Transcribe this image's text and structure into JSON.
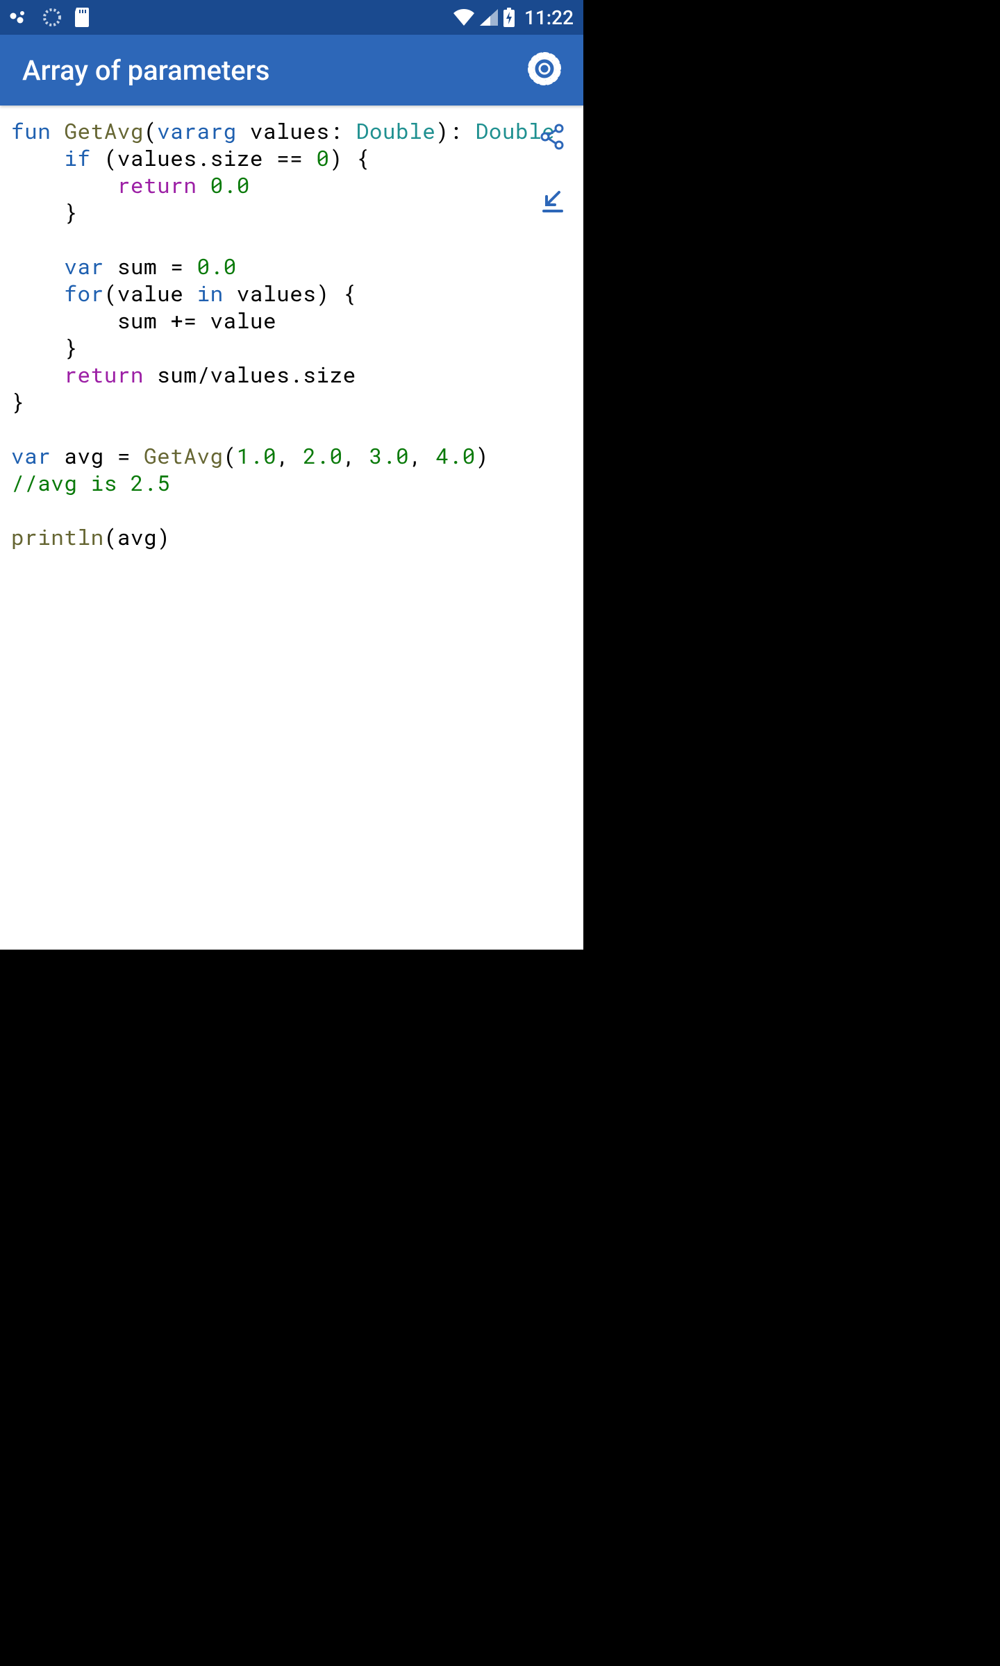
{
  "status": {
    "time": "11:22"
  },
  "appbar": {
    "title": "Array of parameters"
  },
  "code": {
    "tokens": [
      {
        "c": "kw",
        "t": "fun"
      },
      {
        "t": " "
      },
      {
        "c": "fn",
        "t": "GetAvg"
      },
      {
        "t": "("
      },
      {
        "c": "kw",
        "t": "vararg"
      },
      {
        "t": " values: "
      },
      {
        "c": "type",
        "t": "Double"
      },
      {
        "t": "): "
      },
      {
        "c": "type",
        "t": "Double"
      },
      {
        "t": "\n    "
      },
      {
        "c": "kw",
        "t": "if"
      },
      {
        "t": " (values.size == "
      },
      {
        "c": "num",
        "t": "0"
      },
      {
        "t": ") {\n        "
      },
      {
        "c": "mag",
        "t": "return"
      },
      {
        "t": " "
      },
      {
        "c": "num",
        "t": "0.0"
      },
      {
        "t": "\n    }\n\n    "
      },
      {
        "c": "kw",
        "t": "var"
      },
      {
        "t": " sum = "
      },
      {
        "c": "num",
        "t": "0.0"
      },
      {
        "t": "\n    "
      },
      {
        "c": "kw",
        "t": "for"
      },
      {
        "t": "(value "
      },
      {
        "c": "kw",
        "t": "in"
      },
      {
        "t": " values) {\n        sum += value\n    }\n    "
      },
      {
        "c": "mag",
        "t": "return"
      },
      {
        "t": " sum/values.size\n}\n\n"
      },
      {
        "c": "kw",
        "t": "var"
      },
      {
        "t": " avg = "
      },
      {
        "c": "fn",
        "t": "GetAvg"
      },
      {
        "t": "("
      },
      {
        "c": "num",
        "t": "1.0"
      },
      {
        "t": ", "
      },
      {
        "c": "num",
        "t": "2.0"
      },
      {
        "t": ", "
      },
      {
        "c": "num",
        "t": "3.0"
      },
      {
        "t": ", "
      },
      {
        "c": "num",
        "t": "4.0"
      },
      {
        "t": ")\n"
      },
      {
        "c": "cmt",
        "t": "//avg is 2.5"
      },
      {
        "t": "\n\n"
      },
      {
        "c": "fn",
        "t": "println"
      },
      {
        "t": "(avg)"
      }
    ]
  },
  "colors": {
    "statusbar": "#1a4a8f",
    "appbar": "#2d67b8",
    "float_icon": "#2d67b8"
  }
}
